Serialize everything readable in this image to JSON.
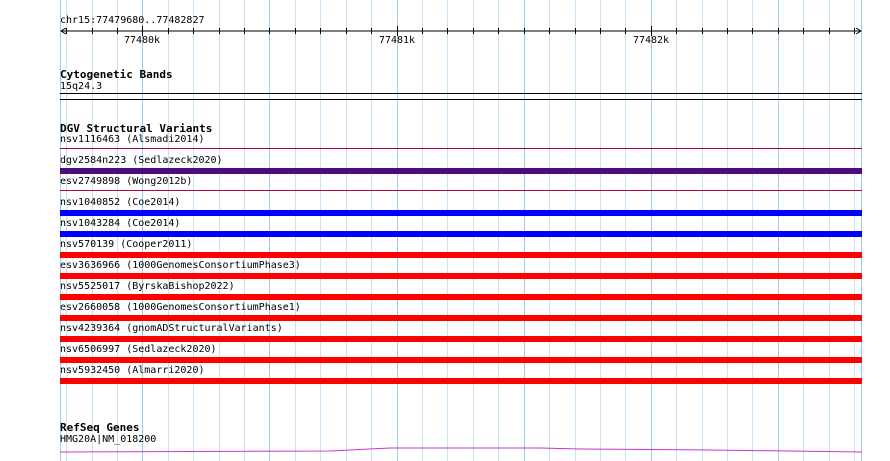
{
  "ruler": {
    "location": "chr15:77479680..77482827",
    "ticks": [
      {
        "label": "77480k",
        "pos": 77480000
      },
      {
        "label": "77481k",
        "pos": 77481000
      },
      {
        "label": "77482k",
        "pos": 77482000
      }
    ]
  },
  "cytoband": {
    "title": "Cytogenetic Bands",
    "band": "15q24.3"
  },
  "dgv": {
    "title": "DGV Structural Variants",
    "items": [
      {
        "label": "nsv1116463 (Alsmadi2014)",
        "color": "#a0004a",
        "style": "line"
      },
      {
        "label": "dgv2584n223 (Sedlazeck2020)",
        "color": "#4b0c82",
        "style": "bar"
      },
      {
        "label": "esv2749898 (Wong2012b)",
        "color": "#c0002e",
        "style": "line"
      },
      {
        "label": "nsv1040852 (Coe2014)",
        "color": "#0000ff",
        "style": "bar"
      },
      {
        "label": "nsv1043284 (Coe2014)",
        "color": "#0000ff",
        "style": "bar"
      },
      {
        "label": "nsv570139 (Cooper2011)",
        "color": "#ff0000",
        "style": "bar"
      },
      {
        "label": "esv3636966 (1000GenomesConsortiumPhase3)",
        "color": "#ff0000",
        "style": "bar"
      },
      {
        "label": "nsv5525017 (ByrskaBishop2022)",
        "color": "#ff0000",
        "style": "bar"
      },
      {
        "label": "esv2660058 (1000GenomesConsortiumPhase1)",
        "color": "#ff0000",
        "style": "bar"
      },
      {
        "label": "nsv4239364 (gnomADStructuralVariants)",
        "color": "#ff0000",
        "style": "bar"
      },
      {
        "label": "nsv6506997 (Sedlazeck2020)",
        "color": "#ff0000",
        "style": "bar"
      },
      {
        "label": "nsv5932450 (Almarri2020)",
        "color": "#ff0000",
        "style": "bar"
      }
    ]
  },
  "refseq": {
    "title": "RefSeq Genes",
    "gene": "HMG20A|NM_018200",
    "color": "#cc33cc"
  },
  "colors": {
    "grid_light": "#c6e2f5",
    "grid_mid": "#9fcbe8"
  }
}
